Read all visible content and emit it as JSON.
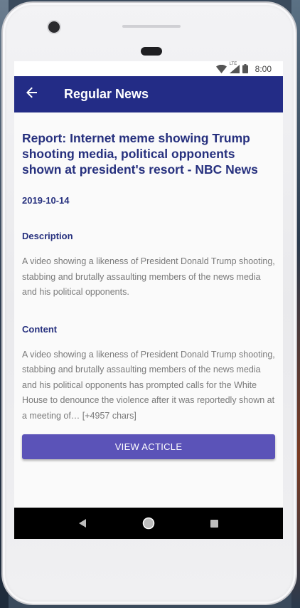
{
  "status": {
    "time": "8:00",
    "network_label": "LTE"
  },
  "app_bar": {
    "title": "Regular News"
  },
  "article": {
    "title": "Report: Internet meme showing Trump shooting media, political opponents shown at president's resort - NBC News",
    "date": "2019-10-14",
    "description_label": "Description",
    "description": "A video showing a likeness of President Donald Trump shooting, stabbing and brutally assaulting members of the news media and his political opponents.",
    "content_label": "Content",
    "content": "A video showing a likeness of President Donald Trump shooting, stabbing and brutally assaulting members of the news media and his political opponents has prompted calls for the White House to denounce the violence after it was reportedly shown at a meeting of… [+4957 chars]",
    "button_label": "VIEW ACTICLE"
  },
  "icons": {
    "back": "arrow-back-icon",
    "wifi": "wifi-icon",
    "signal": "cell-signal-icon",
    "battery": "battery-icon",
    "nav_back": "nav-back-triangle-icon",
    "nav_home": "nav-home-circle-icon",
    "nav_recents": "nav-recents-square-icon"
  },
  "colors": {
    "app_bar": "#232c86",
    "heading_text": "#26307e",
    "body_text": "#7a7a7a",
    "button": "#5b53b8",
    "nav_bar": "#000000"
  }
}
